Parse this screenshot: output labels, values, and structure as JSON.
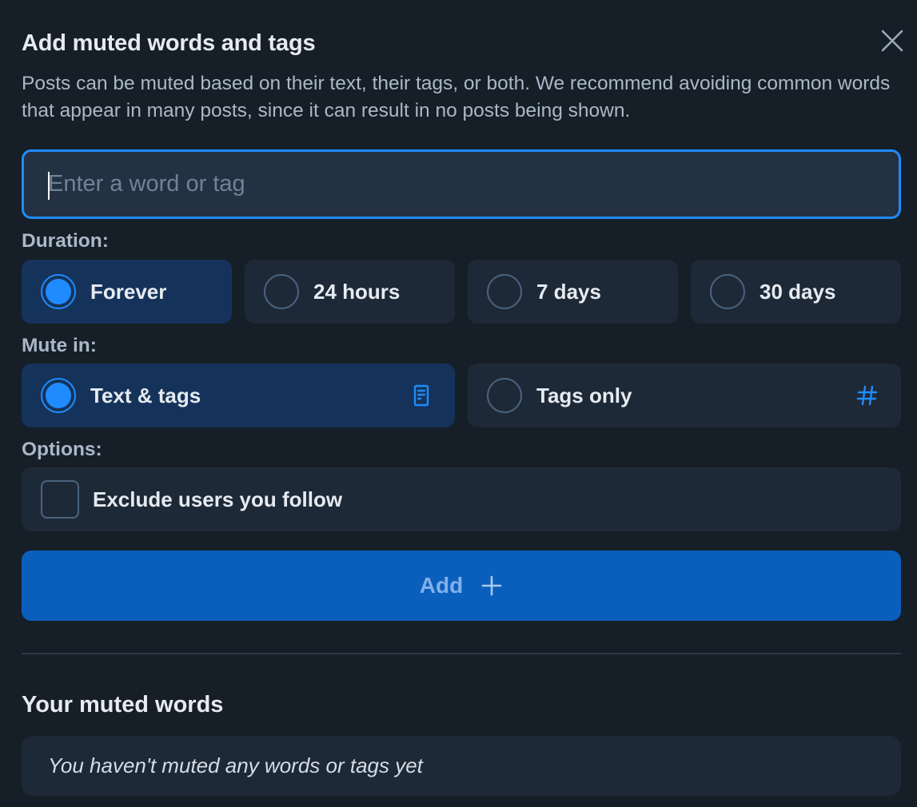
{
  "dialog": {
    "title": "Add muted words and tags",
    "description": "Posts can be muted based on their text, their tags, or both. We recommend avoiding common words that appear in many posts, since it can result in no posts being shown.",
    "close_icon": "close-icon"
  },
  "input": {
    "value": "",
    "placeholder": "Enter a word or tag"
  },
  "duration": {
    "label": "Duration:",
    "options": [
      {
        "label": "Forever",
        "selected": true
      },
      {
        "label": "24 hours",
        "selected": false
      },
      {
        "label": "7 days",
        "selected": false
      },
      {
        "label": "30 days",
        "selected": false
      }
    ]
  },
  "mute_in": {
    "label": "Mute in:",
    "options": [
      {
        "label": "Text & tags",
        "selected": true,
        "icon": "document-icon"
      },
      {
        "label": "Tags only",
        "selected": false,
        "icon": "hashtag-icon"
      }
    ]
  },
  "options": {
    "label": "Options:",
    "exclude_following": {
      "label": "Exclude users you follow",
      "checked": false
    }
  },
  "add_button": {
    "label": "Add",
    "icon": "plus-icon"
  },
  "muted_words": {
    "title": "Your muted words",
    "empty_message": "You haven't muted any words or tags yet",
    "items": []
  },
  "colors": {
    "accent": "#208bfe",
    "background": "#161e27",
    "card": "#1e2937",
    "selected_card": "#15335a",
    "button": "#0b5fbc"
  }
}
